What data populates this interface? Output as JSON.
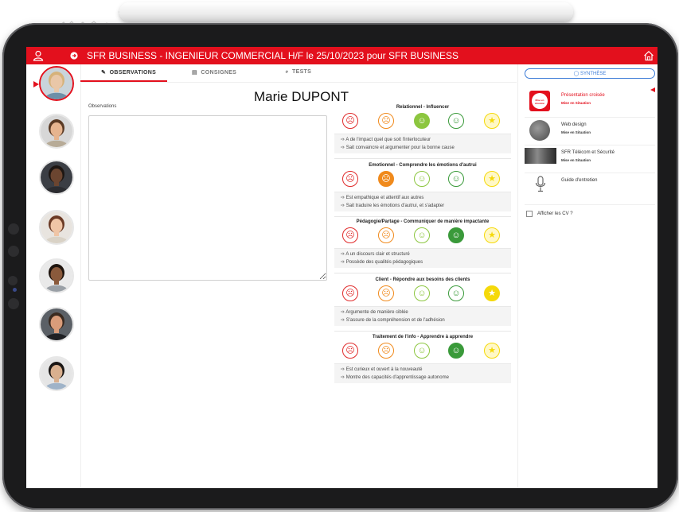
{
  "header": {
    "title": "SFR BUSINESS - INGENIEUR COMMERCIAL H/F le 25/10/2023 pour SFR BUSINESS",
    "bg_color": "#e3101d"
  },
  "icons": {
    "user": "user-icon",
    "next": "arrow-right-circle-icon",
    "home": "home-icon"
  },
  "tabs": [
    {
      "label": "OBSERVATIONS",
      "icon": "edit-icon",
      "active": true
    },
    {
      "label": "CONSIGNES",
      "icon": "list-icon",
      "active": false
    },
    {
      "label": "TESTS",
      "icon": "gauge-icon",
      "active": false
    }
  ],
  "candidates": [
    {
      "active": true,
      "skin": "#e9c7a8",
      "hair": "#d6b27a",
      "bg": "#c9d4db",
      "shirt": "#6d8fa8"
    },
    {
      "active": false,
      "skin": "#e6b48f",
      "hair": "#5a3a24",
      "bg": "#d7d7d7",
      "shirt": "#b7ab97"
    },
    {
      "active": false,
      "skin": "#6b4530",
      "hair": "#1d1612",
      "bg": "#3b3e44",
      "shirt": "#2b2c30"
    },
    {
      "active": false,
      "skin": "#efc5a6",
      "hair": "#6b3a25",
      "bg": "#e8e4df",
      "shirt": "#d9d2c6"
    },
    {
      "active": false,
      "skin": "#8a5a3c",
      "hair": "#1e140e",
      "bg": "#e9e9e9",
      "shirt": "#9aa0a6"
    },
    {
      "active": false,
      "skin": "#d99c7a",
      "hair": "#3a2a20",
      "bg": "#5b6066",
      "shirt": "#1f2024"
    },
    {
      "active": false,
      "skin": "#d9b08f",
      "hair": "#1a1614",
      "bg": "#e5e5e5",
      "shirt": "#9fb3c8"
    }
  ],
  "main": {
    "candidate_name": "Marie DUPONT",
    "observations_label": "Observations"
  },
  "criteria": [
    {
      "title": "Relationnel - Influencer",
      "selected": 2,
      "items": [
        "A de l'impact quel que soit l'interlocuteur",
        "Sait convaincre et argumenter pour la bonne cause"
      ]
    },
    {
      "title": "Emotionnel - Comprendre les émotions d'autrui",
      "selected": 1,
      "items": [
        "Est empathique et attentif aux autres",
        "Sait traduire les émotions d'autrui, et s'adapter"
      ]
    },
    {
      "title": "Pédagogie/Partage - Communiquer de manière impactante",
      "selected": 3,
      "items": [
        "A un discours clair et structuré",
        "Possède des qualités pédagogiques"
      ]
    },
    {
      "title": "Client - Répondre aux besoins des clients",
      "selected": 4,
      "items": [
        "Argumente de manière ciblée",
        "S'assure de la compréhension et de l'adhésion"
      ]
    },
    {
      "title": "Traitement de l'info - Apprendre à apprendre",
      "selected": 3,
      "items": [
        "Est curieux et ouvert à la nouveauté",
        "Montre des capacités d'apprentissage autonome"
      ]
    }
  ],
  "rating_colors": [
    "#e02a2a",
    "#f08a1c",
    "#8cc63f",
    "#3a9a3a",
    "#f5d90a"
  ],
  "rating_icons": [
    "face-angry-icon",
    "face-sad-icon",
    "face-neutral-icon",
    "face-smile-icon",
    "star-icon"
  ],
  "right_panel": {
    "synthese_label": "SYNTHÈSE",
    "items": [
      {
        "title": "Présentation croisée",
        "subtitle": "Mise en Situation",
        "active": true,
        "thumb": "mise-en-situation-logo",
        "thumb_text": "Mise en situation"
      },
      {
        "title": "Web design",
        "subtitle": "Mise en Situation",
        "active": false,
        "thumb": "photo-thumb"
      },
      {
        "title": "SFR Télécom et Sécurité",
        "subtitle": "Mise en Situation",
        "active": false,
        "thumb": "photo-thumb"
      },
      {
        "title": "Guide d'entretien",
        "subtitle": "",
        "active": false,
        "thumb": "microphone-icon"
      }
    ],
    "cv_label": "Afficher les CV ?"
  }
}
